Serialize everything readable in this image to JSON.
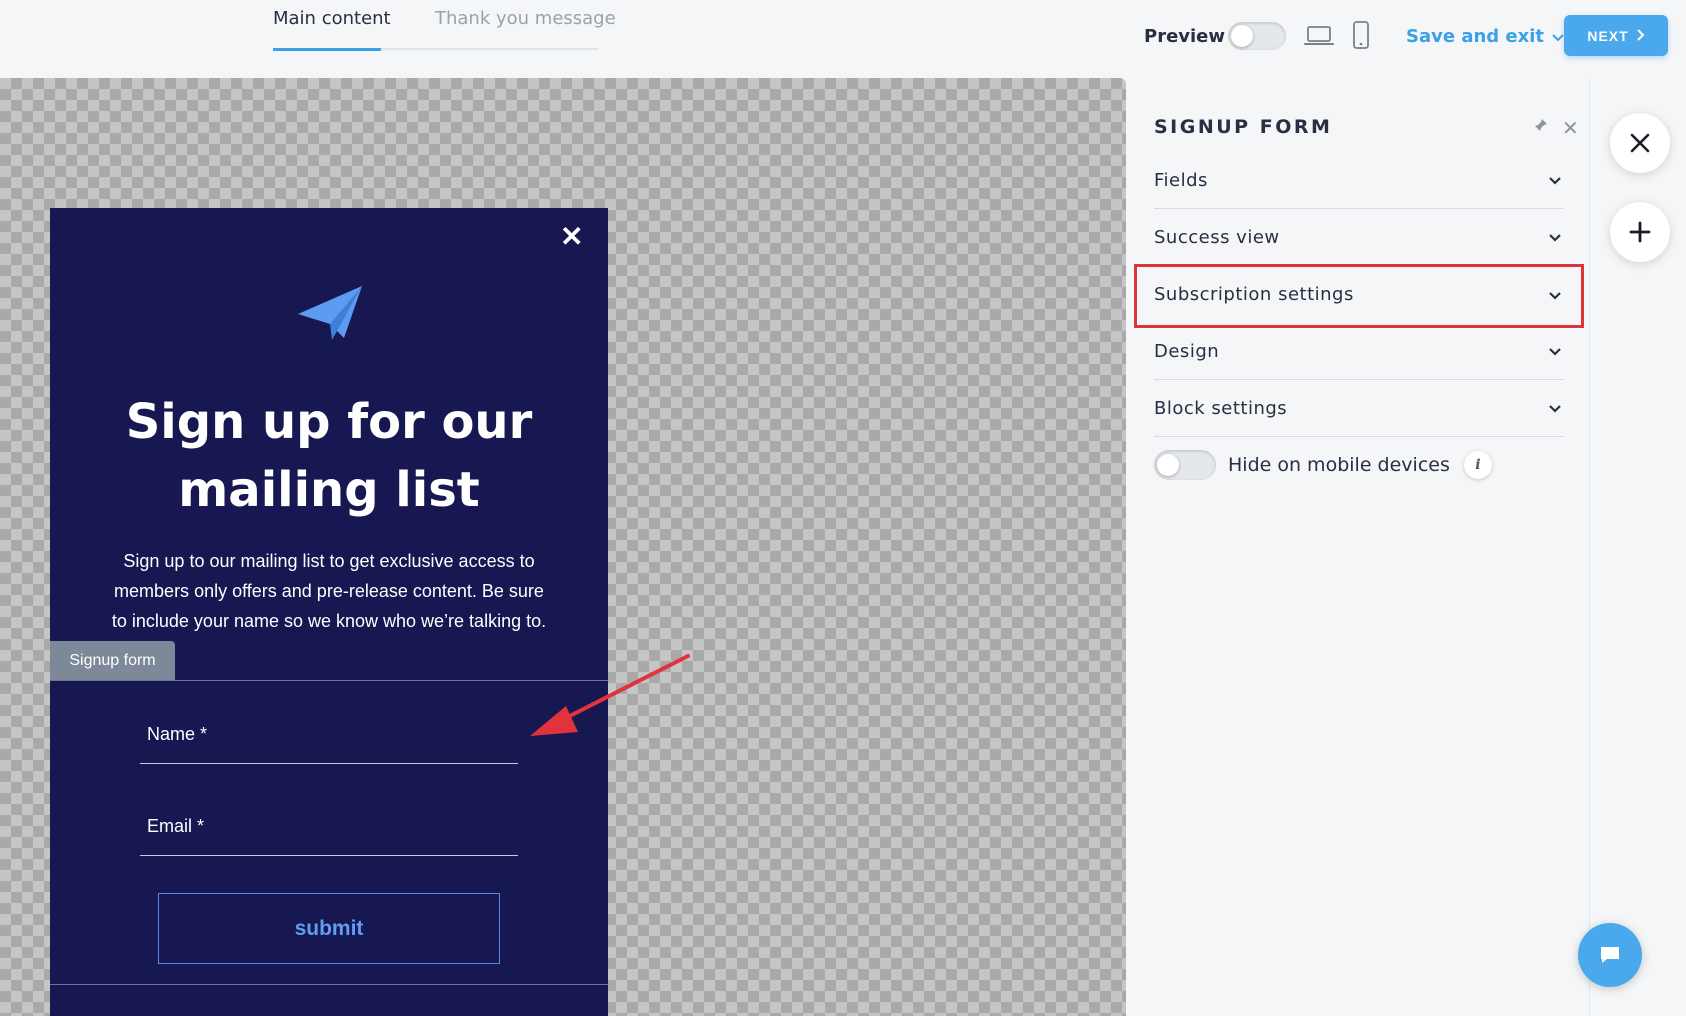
{
  "header": {
    "tabs": [
      {
        "label": "Main content",
        "active": true
      },
      {
        "label": "Thank you message",
        "active": false
      }
    ],
    "preview_label": "Preview",
    "save_exit_label": "Save and exit",
    "next_label": "NEXT"
  },
  "form": {
    "title": "Sign up for our mailing list",
    "description": "Sign up to our mailing list to get exclusive access to members only offers and pre-release content. Be sure to include your name so we know who we’re talking to.",
    "block_tag": "Signup form",
    "fields": [
      {
        "label": "Name *"
      },
      {
        "label": "Email *"
      }
    ],
    "submit_label": "submit"
  },
  "panel": {
    "title": "SIGNUP FORM",
    "sections": [
      {
        "label": "Fields"
      },
      {
        "label": "Success view"
      },
      {
        "label": "Subscription settings",
        "highlighted": true
      },
      {
        "label": "Design"
      },
      {
        "label": "Block settings"
      }
    ],
    "hide_mobile_label": "Hide on mobile devices"
  },
  "colors": {
    "accent": "#3aa0e8",
    "form_bg": "#171752",
    "highlight": "#e0343c"
  },
  "icons": [
    "laptop-icon",
    "phone-icon",
    "paper-plane-icon",
    "pin-icon",
    "close-icon",
    "plus-icon",
    "chat-icon"
  ]
}
